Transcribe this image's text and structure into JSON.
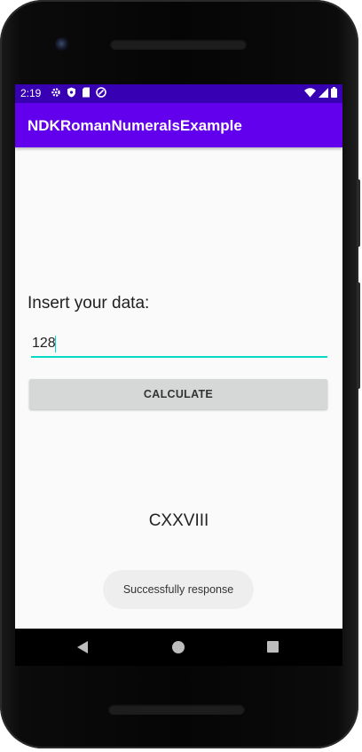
{
  "status_bar": {
    "time": "2:19",
    "left_icons": [
      "gear-icon",
      "shield-icon",
      "sd-card-icon",
      "vpn-key-icon"
    ],
    "right_icons": [
      "wifi-icon",
      "cellular-signal-icon",
      "battery-icon"
    ]
  },
  "app_bar": {
    "title": "NDKRomanNumeralsExample"
  },
  "form": {
    "prompt_label": "Insert your data:",
    "input_value": "128",
    "calculate_label": "CALCULATE"
  },
  "result": {
    "text": "CXXVIII"
  },
  "toast": {
    "message": "Successfully response"
  },
  "nav_bar": {
    "buttons": [
      "back-icon",
      "home-icon",
      "recents-icon"
    ]
  },
  "colors": {
    "status_bar": "#3700b3",
    "app_bar": "#6200ee",
    "accent": "#03dac5",
    "button_bg": "#d6d7d7",
    "screen_bg": "#fafafa"
  }
}
